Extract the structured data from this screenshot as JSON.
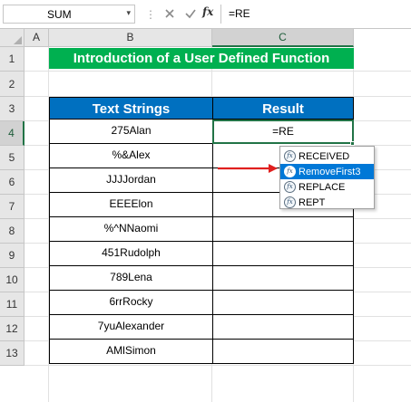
{
  "formula_bar": {
    "name_box": "SUM",
    "name_box_arrow": "▾",
    "separator": "⋮",
    "fx_label": "fx",
    "formula": "=RE"
  },
  "columns": [
    "A",
    "B",
    "C"
  ],
  "rows": [
    "1",
    "2",
    "3",
    "4",
    "5",
    "6",
    "7",
    "8",
    "9",
    "10",
    "11",
    "12",
    "13"
  ],
  "title": "Introduction of a User Defined Function",
  "table": {
    "headers": [
      "Text Strings",
      "Result"
    ],
    "text_strings": [
      "275Alan",
      "%&Alex",
      "JJJJordan",
      "EEEElon",
      "%^NNaomi",
      "451Rudolph",
      "789Lena",
      "6rrRocky",
      "7yuAlexander",
      "AMlSimon"
    ],
    "active_cell_value": "=RE"
  },
  "autocomplete": {
    "icon_label": "fx",
    "items": [
      "RECEIVED",
      "RemoveFirst3",
      "REPLACE",
      "REPT"
    ],
    "selected_index": 1
  },
  "colors": {
    "title_bg": "#00b050",
    "header_bg": "#0070c0",
    "selection": "#217346",
    "arrow": "#e0201f",
    "highlight": "#0078d7"
  }
}
